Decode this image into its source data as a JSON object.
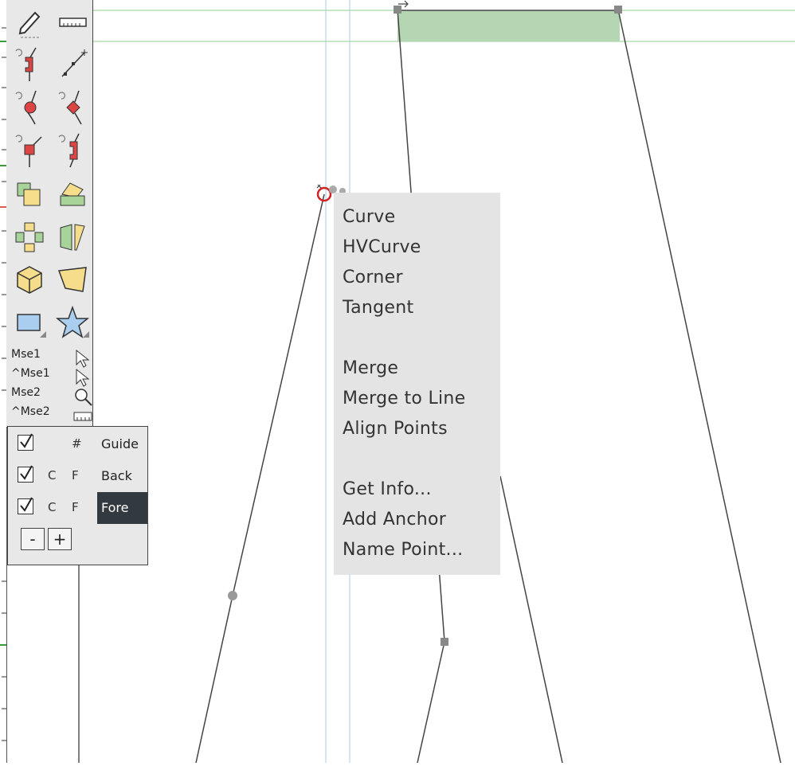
{
  "toolbox": {
    "tools": [
      {
        "name": "pencil-tool-icon"
      },
      {
        "name": "ruler-tool-icon"
      },
      {
        "name": "add-hv-curve-point-icon"
      },
      {
        "name": "knife-tool-icon"
      },
      {
        "name": "add-curve-point-icon"
      },
      {
        "name": "add-corner-point-icon"
      },
      {
        "name": "add-tangent-point-icon"
      },
      {
        "name": "add-hv-point-icon"
      },
      {
        "name": "scale-tool-icon"
      },
      {
        "name": "skew-tool-icon"
      },
      {
        "name": "rotate-tool-icon"
      },
      {
        "name": "flip-tool-icon"
      },
      {
        "name": "3d-rotate-tool-icon"
      },
      {
        "name": "perspective-tool-icon"
      },
      {
        "name": "rectangle-tool-icon"
      },
      {
        "name": "star-tool-icon"
      }
    ],
    "mouse_labels": [
      "Mse1",
      "^Mse1",
      "Mse2",
      "^Mse2"
    ]
  },
  "layers": {
    "rows": [
      {
        "checked": true,
        "c": "",
        "f": "#",
        "name": "Guide",
        "active": false
      },
      {
        "checked": true,
        "c": "C",
        "f": "F",
        "name": "Back",
        "active": false
      },
      {
        "checked": true,
        "c": "C",
        "f": "F",
        "name": "Fore",
        "active": true
      }
    ],
    "minus_label": "-",
    "plus_label": "+"
  },
  "context_menu": {
    "items": [
      "Curve",
      "HVCurve",
      "Corner",
      "Tangent",
      "Merge",
      "Merge to Line",
      "Align Points",
      "Get Info...",
      "Add Anchor",
      "Name Point..."
    ]
  },
  "colors": {
    "selection_fill": "#b5d6b3",
    "guide_green": "#8fcf8f",
    "guide_blue": "#a9c8e8",
    "selected_point": "#d22222",
    "menu_bg": "#e4e4e4",
    "toolbox_bg": "#e8e8e8",
    "active_layer_bg": "#333a3f"
  }
}
